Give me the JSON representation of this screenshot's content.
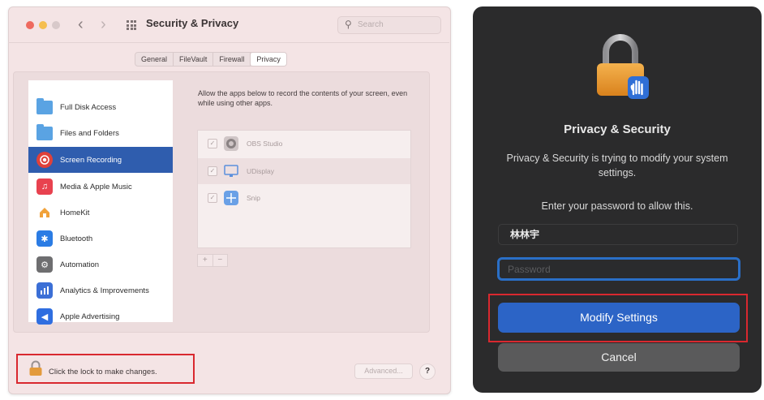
{
  "prefs_window": {
    "title": "Security & Privacy",
    "search_placeholder": "Search",
    "tabs": [
      {
        "label": "General",
        "active": false
      },
      {
        "label": "FileVault",
        "active": false
      },
      {
        "label": "Firewall",
        "active": false
      },
      {
        "label": "Privacy",
        "active": true
      }
    ],
    "sidebar": {
      "items": [
        {
          "label": "Full Disk Access",
          "icon": "folder-icon",
          "selected": false
        },
        {
          "label": "Files and Folders",
          "icon": "folder-icon",
          "selected": false
        },
        {
          "label": "Screen Recording",
          "icon": "screen-recording-icon",
          "selected": true
        },
        {
          "label": "Media & Apple Music",
          "icon": "music-icon",
          "selected": false
        },
        {
          "label": "HomeKit",
          "icon": "home-icon",
          "selected": false
        },
        {
          "label": "Bluetooth",
          "icon": "bluetooth-icon",
          "selected": false
        },
        {
          "label": "Automation",
          "icon": "gear-icon",
          "selected": false
        },
        {
          "label": "Analytics & Improvements",
          "icon": "analytics-icon",
          "selected": false
        },
        {
          "label": "Apple Advertising",
          "icon": "megaphone-icon",
          "selected": false
        }
      ]
    },
    "description": "Allow the apps below to record the contents of your screen, even while using other apps.",
    "apps": [
      {
        "name": "OBS Studio",
        "checked": true
      },
      {
        "name": "UDisplay",
        "checked": true
      },
      {
        "name": "Snip",
        "checked": true
      }
    ],
    "add_label": "+",
    "remove_label": "−",
    "lock_text": "Click the lock to make changes.",
    "advanced_label": "Advanced...",
    "help_label": "?"
  },
  "auth_dialog": {
    "title": "Privacy & Security",
    "message": "Privacy & Security is trying to modify your system settings.",
    "prompt": "Enter your password to allow this.",
    "username": "林林宇",
    "password_placeholder": "Password",
    "modify_label": "Modify Settings",
    "cancel_label": "Cancel"
  },
  "colors": {
    "highlight_red": "#d9282f",
    "selection_blue": "#2f5dae",
    "dialog_bg": "#2b2b2c",
    "primary_button": "#2c64c6"
  }
}
